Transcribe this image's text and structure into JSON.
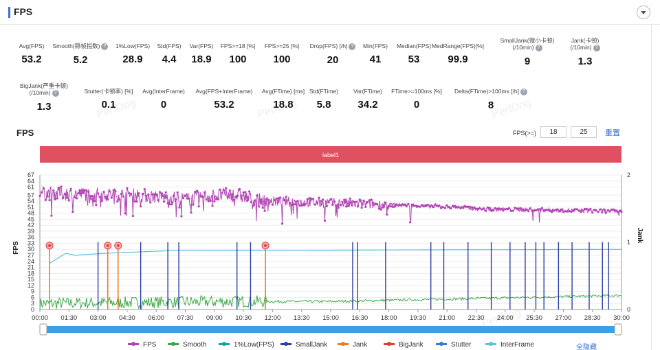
{
  "header": {
    "title": "FPS"
  },
  "stats": [
    {
      "label": "Avg(FPS)",
      "value": "53.2"
    },
    {
      "label": "Smooth(稳帧指数)",
      "value": "5.2",
      "help": true
    },
    {
      "label": "1%Low(FPS)",
      "value": "28.9"
    },
    {
      "label": "Std(FPS)",
      "value": "4.4"
    },
    {
      "label": "Var(FPS)",
      "value": "18.9"
    },
    {
      "label": "FPS>=18 [%]",
      "value": "100"
    },
    {
      "label": "FPS>=25 [%]",
      "value": "100"
    },
    {
      "label": "Drop(FPS) [/h]",
      "value": "20",
      "help": true
    },
    {
      "label": "Min(FPS)",
      "value": "41"
    },
    {
      "label": "Median(FPS)",
      "value": "53"
    },
    {
      "label": "MedRange(FPS)[%]",
      "value": "99.9"
    },
    {
      "label": "SmallJank(微小卡顿)",
      "label2": "(/10min)",
      "value": "9",
      "help": true
    },
    {
      "label": "Jank(卡顿)",
      "label2": "(/10min)",
      "value": "1.3",
      "help": true
    },
    {
      "label": "BigJank(严重卡顿)",
      "label2": "(/10min)",
      "value": "1.3",
      "help": true
    },
    {
      "label": "Stutter(卡顿率) [%]",
      "value": "0.1"
    },
    {
      "label": "Avg(InterFrame)",
      "value": "0"
    },
    {
      "label": "Avg(FPS+InterFrame)",
      "value": "53.2"
    },
    {
      "label": "Avg(FTime) [ms]",
      "value": "18.8"
    },
    {
      "label": "Std(FTime)",
      "value": "5.8"
    },
    {
      "label": "Var(FTime)",
      "value": "34.2"
    },
    {
      "label": "FTime>=100ms [%]",
      "value": "0"
    },
    {
      "label": "Delta(FTime)>100ms [/h]",
      "value": "8",
      "help": true
    }
  ],
  "watermark": "PerfDog",
  "fps_section": {
    "title": "FPS",
    "threshold_label": "FPS(>=)",
    "threshold1": "18",
    "threshold2": "25",
    "reset_label": "重置",
    "hide_all_label": "全隐藏"
  },
  "colors": {
    "fps": "#b245b5",
    "smooth": "#3aa845",
    "low1": "#16a59a",
    "smalljank": "#2a3ea8",
    "jank": "#f07a1e",
    "bigjank": "#e03a3a",
    "stutter": "#3a7bd5",
    "interframe": "#5bc0d8",
    "label_band": "#e05060",
    "slider": "#3aa0e8"
  },
  "chart_data": {
    "type": "line",
    "title": "FPS",
    "band_label": "label1",
    "xlabel": "",
    "ylabel": "FPS",
    "y2label": "Jank",
    "x_ticks": [
      "00:00",
      "01:30",
      "03:00",
      "04:30",
      "06:00",
      "07:30",
      "09:00",
      "10:30",
      "12:00",
      "13:30",
      "15:00",
      "16:30",
      "18:00",
      "19:30",
      "21:00",
      "22:30",
      "24:00",
      "25:30",
      "27:00",
      "28:30",
      "30:00"
    ],
    "xlim_seconds": [
      0,
      1800
    ],
    "y_ticks": [
      0,
      3,
      6,
      9,
      12,
      15,
      18,
      21,
      24,
      27,
      30,
      33,
      36,
      39,
      42,
      45,
      48,
      51,
      54,
      57,
      61,
      64,
      67
    ],
    "ylim": [
      0,
      67
    ],
    "y2_ticks": [
      0,
      1,
      2
    ],
    "y2lim": [
      0,
      2
    ],
    "fps_profile_seconds_to_fps": [
      [
        0,
        58
      ],
      [
        300,
        57
      ],
      [
        460,
        55
      ],
      [
        540,
        57
      ],
      [
        610,
        57
      ],
      [
        690,
        54
      ],
      [
        930,
        53
      ],
      [
        1290,
        51
      ],
      [
        1370,
        50
      ],
      [
        1800,
        49
      ]
    ],
    "fps_min": 41,
    "smooth_profile": [
      [
        0,
        3
      ],
      [
        600,
        4
      ],
      [
        900,
        4
      ],
      [
        1200,
        5
      ],
      [
        1500,
        6
      ],
      [
        1800,
        7
      ]
    ],
    "low1_profile": [
      [
        30,
        23
      ],
      [
        80,
        28
      ],
      [
        110,
        27
      ],
      [
        200,
        28
      ],
      [
        400,
        29.3
      ],
      [
        1800,
        30
      ]
    ],
    "smalljank_times": [
      180,
      312,
      396,
      430,
      610,
      652,
      968,
      983,
      1070,
      1210,
      1250,
      1325,
      1397,
      1455,
      1502,
      1535,
      1560,
      1605,
      1647,
      1700,
      1741,
      1760
    ],
    "jank_events": [
      [
        30,
        0.95
      ],
      [
        210,
        0.95
      ],
      [
        242,
        0.95
      ],
      [
        698,
        0.95
      ]
    ],
    "series": [
      {
        "name": "FPS"
      },
      {
        "name": "Smooth"
      },
      {
        "name": "1%Low(FPS)"
      },
      {
        "name": "SmallJank"
      },
      {
        "name": "Jank"
      },
      {
        "name": "BigJank"
      },
      {
        "name": "Stutter"
      },
      {
        "name": "InterFrame"
      }
    ],
    "legend_position": "bottom"
  }
}
